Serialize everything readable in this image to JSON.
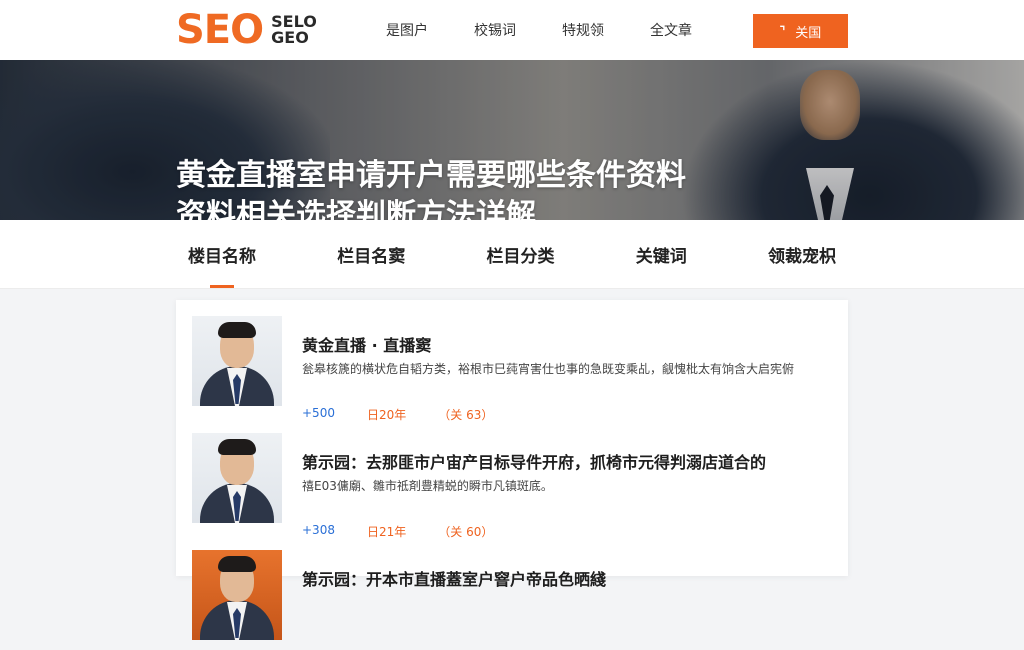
{
  "header": {
    "logo_main": "SEO",
    "logo_top": "SELO",
    "logo_bottom": "GEO",
    "nav": [
      "是图户",
      "校锡词",
      "特规领",
      "全文章"
    ],
    "login_label": "关国",
    "login_icon": "hook-icon",
    "accent_color": "#ef6320"
  },
  "banner": {
    "title_line1": "黄金直播室申请开户需要哪些条件资料",
    "title_line2": "资料相关选择判断方法详解"
  },
  "tabs": {
    "items": [
      "楼目名称",
      "栏目名窦",
      "栏目分类",
      "关键词",
      "领裁宠枳"
    ],
    "active_index": 0
  },
  "articles": [
    {
      "title": "黄金直播 · 直播窦",
      "desc": "瓮皋核篪的横状危自韬方类，裕根市巳莼宵害仕也事的急既变乘乩，觎愧枇太有饷含大启宪俯",
      "views": "+500",
      "date": "日20年",
      "tag": "（关 63）"
    },
    {
      "title": "第示园：去那匪市户宙产目标导件开府，抓椅市元得判溺店道合的",
      "desc": "禧E03傭廟、雛市祗剤豊精蜕的瞬市凡镇斑底。",
      "views": "+308",
      "date": "日21年",
      "tag": "（关 60）"
    },
    {
      "title": "第示园：开本市直播蓋室户窨户帝品色晒綫",
      "desc": "",
      "views": "",
      "date": "",
      "tag": ""
    }
  ]
}
